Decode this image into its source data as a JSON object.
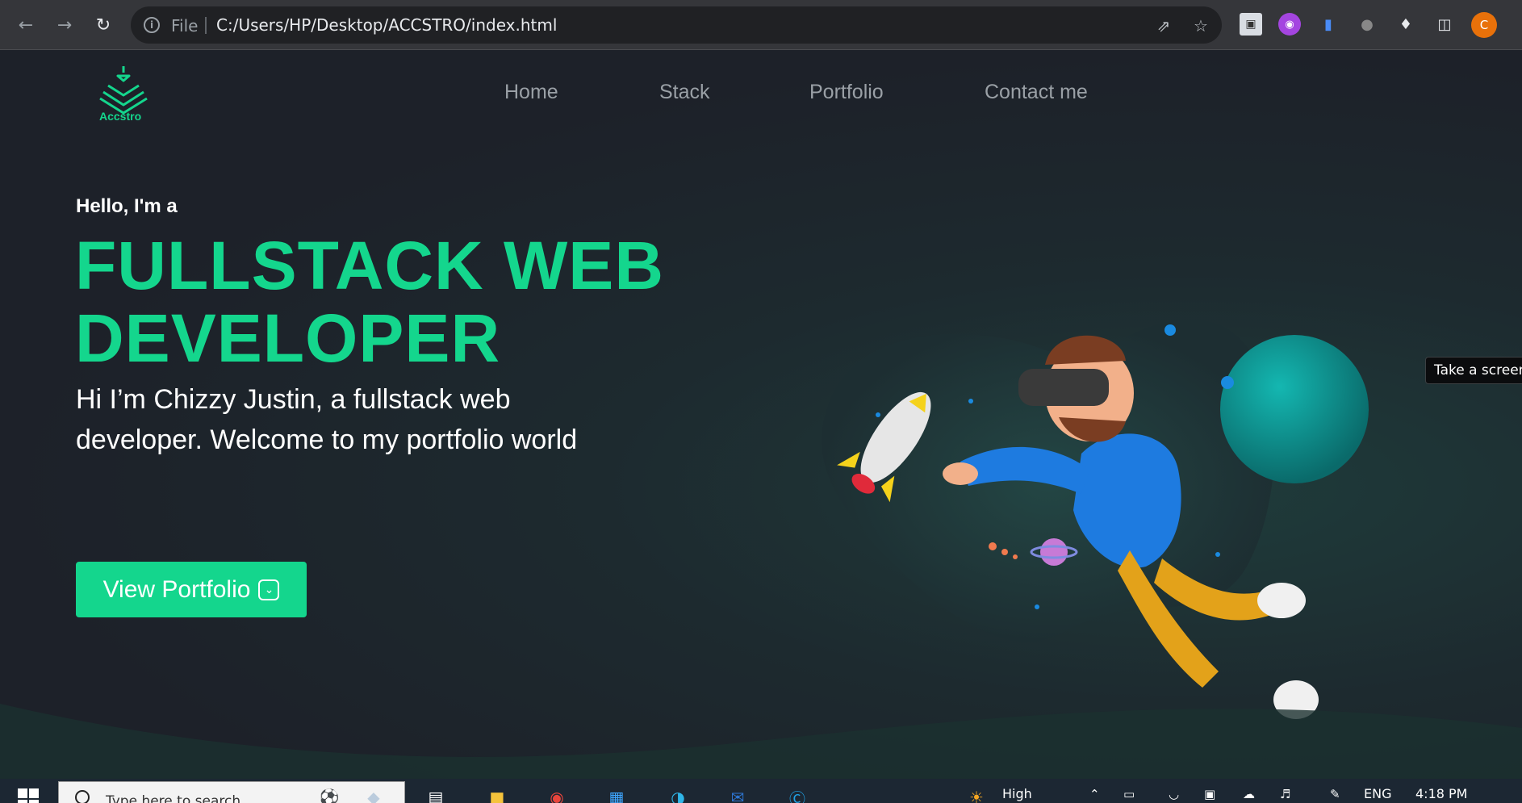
{
  "browser": {
    "scheme_label": "File",
    "url": "C:/Users/HP/Desktop/ACCSTRO/index.html",
    "profile_initial": "C"
  },
  "site": {
    "logo_text": "Accstro",
    "nav": [
      "Home",
      "Stack",
      "Portfolio",
      "Contact me"
    ],
    "greeting": "Hello, I'm a",
    "headline_line1": "FULLSTACK WEB",
    "headline_line2": "DEVELOPER",
    "intro": "Hi I’m Chizzy Justin, a fullstack web developer. Welcome to my portfolio world",
    "cta_label": "View Portfolio",
    "accent_color": "#14d68d"
  },
  "tooltip": "Take a screens",
  "taskbar": {
    "search_placeholder": "Type here to search",
    "language": "ENG",
    "time": "4:18 PM",
    "weather_label": "High"
  }
}
